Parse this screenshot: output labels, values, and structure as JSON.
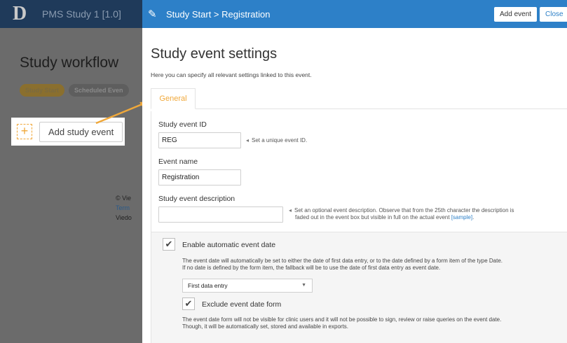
{
  "background": {
    "app_title": "PMS Study 1 [1.0]",
    "heading": "Study workflow",
    "pills": [
      "Study Start",
      "Scheduled Even"
    ],
    "add_study_event": "Add study event",
    "footer": [
      "© Vie",
      "Term",
      "Viedo"
    ]
  },
  "panel": {
    "breadcrumb": "Study Start > Registration",
    "add_event_button": "Add event",
    "close_button": "Close",
    "title": "Study event settings",
    "subtitle": "Here you can specify all relevant settings linked to this event.",
    "tab_general": "General"
  },
  "form": {
    "event_id": {
      "label": "Study event ID",
      "value": "REG",
      "hint": "Set a unique event ID."
    },
    "event_name": {
      "label": "Event name",
      "value": "Registration"
    },
    "event_description": {
      "label": "Study event description",
      "value": "",
      "hint_prefix": "Set an optional event description. Observe that from the 25th character the description is",
      "hint_line2": "faded out in the event box but visible in full on the actual event",
      "hint_link": "[sample]",
      "hint_suffix": "."
    },
    "auto_date": {
      "label": "Enable automatic event date",
      "checked": true,
      "desc_line1": "The event date will automatically be set to either the date of first data entry, or to the date defined by a form item of the type Date.",
      "desc_line2": "If no date is defined by the form item, the fallback will be to use the date of first data entry as event date.",
      "select_value": "First data entry"
    },
    "exclude_form": {
      "label": "Exclude event date form",
      "checked": true,
      "desc_line1": "The event date form will not be visible for clinic users and it will not be possible to sign, review or raise queries on the event date.",
      "desc_line2": "Though, it will be automatically set, stored and available in exports."
    }
  },
  "colors": {
    "header_blue": "#2d80c8",
    "accent_orange": "#f0a83a",
    "dim_background": "#6b6b6b"
  },
  "icons": {
    "pencil": "pencil-icon",
    "plus": "plus-icon",
    "checkmark": "checkmark-icon",
    "chevron": "chevron-down-icon",
    "arrow": "arrow-annotation-icon"
  }
}
